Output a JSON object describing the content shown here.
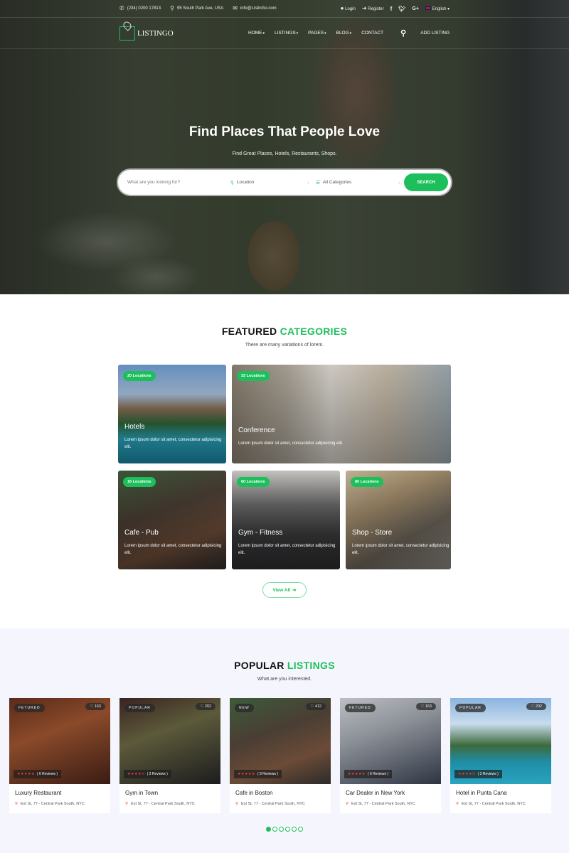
{
  "topbar": {
    "phone": "(234) 0200 17813",
    "address": "95 South Park Ave, USA",
    "email": "info@ListinGo.com",
    "login": "Login",
    "register": "Register",
    "social": [
      "f",
      "t",
      "G+"
    ],
    "language": "English"
  },
  "nav": {
    "logo": "LISTINGO",
    "items": [
      {
        "label": "HOME",
        "dropdown": true
      },
      {
        "label": "LISTINGS",
        "dropdown": true
      },
      {
        "label": "PAGES",
        "dropdown": true
      },
      {
        "label": "BLOG",
        "dropdown": true
      },
      {
        "label": "CONTACT",
        "dropdown": false
      }
    ],
    "add_listing": "ADD LISTING"
  },
  "hero": {
    "title": "Find Places That People Love",
    "subtitle": "Find Great Places, Hotels, Restaurants, Shops.",
    "search_placeholder": "What are you looking for?",
    "location_label": "Location",
    "category_label": "All Categories",
    "search_button": "SEARCH"
  },
  "featured": {
    "title_a": "FEATURED",
    "title_b": "CATEGORIES",
    "subtitle": "There are many variations of lorem.",
    "cards": [
      {
        "badge": "20 Locations",
        "title": "Hotels",
        "desc": "Lorem ipsum dolor sit amet, consectetur adipisicing elit."
      },
      {
        "badge": "33 Locations",
        "title": "Conference",
        "desc": "Lorem ipsum dolor sit amet, consectetur adipisicing elit."
      },
      {
        "badge": "16 Locations",
        "title": "Cafe - Pub",
        "desc": "Lorem ipsum dolor sit amet, consectetur adipisicing elit."
      },
      {
        "badge": "60 Locations",
        "title": "Gym - Fitness",
        "desc": "Lorem ipsum dolor sit amet, consectetur adipisicing elit."
      },
      {
        "badge": "80 Locations",
        "title": "Shop - Store",
        "desc": "Lorem ipsum dolor sit amet, consectetur adipisicing elit."
      }
    ],
    "view_all": "View All"
  },
  "popular": {
    "title_a": "POPULAR",
    "title_b": "LISTINGS",
    "subtitle": "What are you interested.",
    "listings": [
      {
        "tag": "FETURED",
        "likes": "163",
        "rating": 5,
        "reviews": "( 6 Reviews )",
        "name": "Luxury Restaurant",
        "address": "Est St, 77 - Central Park South, NYC"
      },
      {
        "tag": "POPULAR",
        "likes": "202",
        "rating": 4.5,
        "reviews": "( 3 Reviews )",
        "name": "Gym in Town",
        "address": "Est St, 77 - Central Park South, NYC"
      },
      {
        "tag": "NEW",
        "likes": "412",
        "rating": 5,
        "reviews": "( 9 Reviews )",
        "name": "Cafe in Boston",
        "address": "Est St, 77 - Central Park South, NYC"
      },
      {
        "tag": "FETURED",
        "likes": "163",
        "rating": 5,
        "reviews": "( 6 Reviews )",
        "name": "Car Dealer in New York",
        "address": "Est St, 77 - Central Park South, NYC"
      },
      {
        "tag": "POPULAR",
        "likes": "202",
        "rating": 4.5,
        "reviews": "( 3 Reviews )",
        "name": "Hotel in Punta Cana",
        "address": "Est St, 77 - Central Park South, NYC"
      }
    ],
    "carousel_pages": 6,
    "carousel_active": 1
  },
  "colors": {
    "accent": "#1dbf5c",
    "star": "#ff3d3d",
    "section_bg": "#f5f6fd"
  }
}
